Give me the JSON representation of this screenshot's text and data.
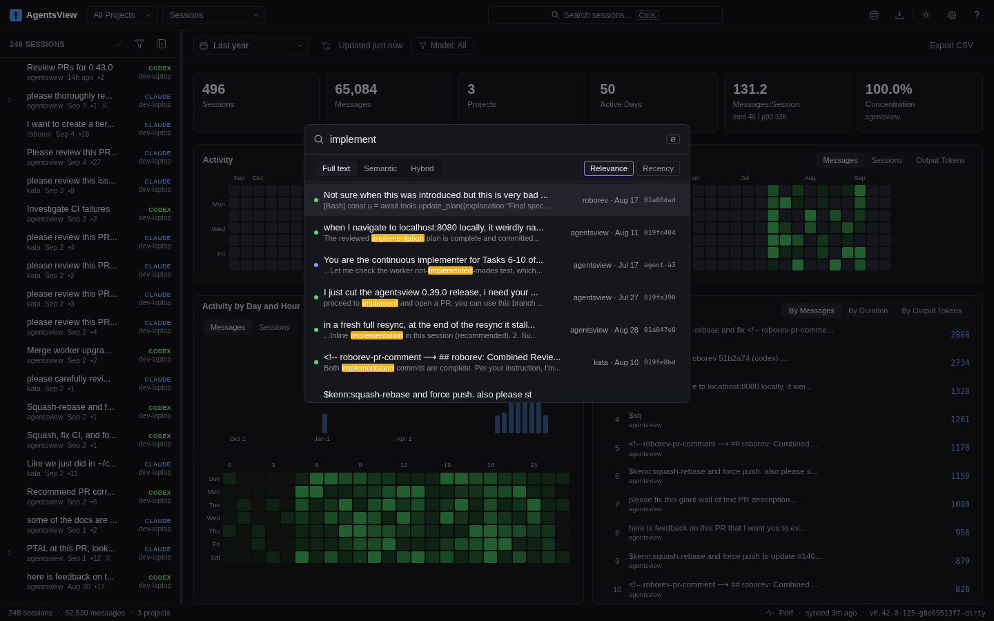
{
  "header": {
    "app_name": "AgentsView",
    "project_filter": "All Projects",
    "view_select": "Sessions",
    "search_placeholder": "Search sessions...",
    "search_shortcut": "CtrlK"
  },
  "sidebar": {
    "count_label": "248 SESSIONS",
    "items": [
      {
        "title": "Review PRs for 0.43.0",
        "project": "agentsview",
        "date": "14h ago",
        "count": "•2",
        "agent": "CODEX",
        "color": "#3f8f4f",
        "machine": "dev-laptop",
        "expandable": false,
        "person_icon": false
      },
      {
        "title": "please thoroughly re...",
        "project": "agentsview",
        "date": "Sep 7",
        "count": "•1",
        "agent": "CLAUDE",
        "color": "#3b5f94",
        "machine": "dev-laptop",
        "expandable": true,
        "person_icon": true
      },
      {
        "title": "I want to create a tier...",
        "project": "roborev",
        "date": "Sep 4",
        "count": "•18",
        "agent": "CLAUDE",
        "color": "#3b5f94",
        "machine": "dev-laptop",
        "expandable": false,
        "person_icon": false
      },
      {
        "title": "Please review this PR...",
        "project": "agentsview",
        "date": "Sep 4",
        "count": "•27",
        "agent": "CLAUDE",
        "color": "#3b5f94",
        "machine": "dev-laptop",
        "expandable": false,
        "person_icon": false
      },
      {
        "title": "please review this iss...",
        "project": "kata",
        "date": "Sep 3",
        "count": "•8",
        "agent": "CLAUDE",
        "color": "#3b5f94",
        "machine": "dev-laptop",
        "expandable": false,
        "person_icon": false
      },
      {
        "title": "Investigate CI failures",
        "project": "agentsview",
        "date": "Sep 3",
        "count": "•2",
        "agent": "CODEX",
        "color": "#3f8f4f",
        "machine": "dev-laptop",
        "expandable": false,
        "person_icon": false
      },
      {
        "title": "please review this PR...",
        "project": "kata",
        "date": "Sep 2",
        "count": "•4",
        "agent": "CLAUDE",
        "color": "#3b5f94",
        "machine": "dev-laptop",
        "expandable": false,
        "person_icon": false
      },
      {
        "title": "please review this PR...",
        "project": "kata",
        "date": "Sep 2",
        "count": "•2",
        "agent": "CLAUDE",
        "color": "#3b5f94",
        "machine": "dev-laptop",
        "expandable": false,
        "person_icon": false
      },
      {
        "title": "please review this PR...",
        "project": "kata",
        "date": "Sep 2",
        "count": "•3",
        "agent": "CLAUDE",
        "color": "#3b5f94",
        "machine": "dev-laptop",
        "expandable": false,
        "person_icon": false
      },
      {
        "title": "please review this PR...",
        "project": "agentsview",
        "date": "Sep 2",
        "count": "•4",
        "agent": "CLAUDE",
        "color": "#3b5f94",
        "machine": "dev-laptop",
        "expandable": false,
        "person_icon": false
      },
      {
        "title": "Merge worker upgra...",
        "project": "agentsview",
        "date": "Sep 2",
        "count": "•2",
        "agent": "CODEX",
        "color": "#3f8f4f",
        "machine": "dev-laptop",
        "expandable": false,
        "person_icon": false
      },
      {
        "title": "please carefully revi...",
        "project": "kata",
        "date": "Sep 2",
        "count": "•1",
        "agent": "CLAUDE",
        "color": "#3b5f94",
        "machine": "dev-laptop",
        "expandable": false,
        "person_icon": false
      },
      {
        "title": "Squash-rebase and f...",
        "project": "agentsview",
        "date": "Sep 2",
        "count": "•1",
        "agent": "CODEX",
        "color": "#3f8f4f",
        "machine": "dev-laptop",
        "expandable": false,
        "person_icon": false
      },
      {
        "title": "Squash, fix CI, and fo...",
        "project": "agentsview",
        "date": "Sep 2",
        "count": "•1",
        "agent": "CODEX",
        "color": "#3f8f4f",
        "machine": "dev-laptop",
        "expandable": false,
        "person_icon": false
      },
      {
        "title": "Like we just did in ~/c...",
        "project": "kata",
        "date": "Sep 2",
        "count": "•11",
        "agent": "CLAUDE",
        "color": "#3b5f94",
        "machine": "dev-laptop",
        "expandable": false,
        "person_icon": false
      },
      {
        "title": "Recommend PR corr...",
        "project": "agentsview",
        "date": "Sep 2",
        "count": "•5",
        "agent": "CODEX",
        "color": "#3f8f4f",
        "machine": "dev-laptop",
        "expandable": false,
        "person_icon": false
      },
      {
        "title": "some of the docs are ...",
        "project": "agentsview",
        "date": "Sep 1",
        "count": "•2",
        "agent": "CLAUDE",
        "color": "#3b5f94",
        "machine": "dev-laptop",
        "expandable": false,
        "person_icon": false
      },
      {
        "title": "PTAL at this PR, look...",
        "project": "agentsview",
        "date": "Sep 1",
        "count": "•12",
        "agent": "CLAUDE",
        "color": "#3b5f94",
        "machine": "dev-laptop",
        "expandable": true,
        "person_icon": true
      },
      {
        "title": "here is feedback on t...",
        "project": "agentsview",
        "date": "Aug 30",
        "count": "•17",
        "agent": "CODEX",
        "color": "#3f8f4f",
        "machine": "dev-laptop",
        "expandable": false,
        "person_icon": false
      }
    ]
  },
  "toolbar": {
    "date_range": "Last year",
    "updated": "Updated just now",
    "model_filter": "Model: All",
    "export": "Export CSV"
  },
  "stats": [
    {
      "value": "496",
      "label": "Sessions"
    },
    {
      "value": "65,084",
      "label": "Messages"
    },
    {
      "value": "3",
      "label": "Projects"
    },
    {
      "value": "50",
      "label": "Active Days"
    },
    {
      "value": "131.2",
      "label": "Messages/Session",
      "sub": "med 46 / p90 336"
    },
    {
      "value": "100.0%",
      "label": "Concentration",
      "sub": "agentsview"
    }
  ],
  "activity": {
    "title": "Activity",
    "left_months": [
      "Sep",
      "Oct"
    ],
    "right_months": [
      "un",
      "Jul",
      "Aug",
      "Sep"
    ],
    "days": [
      "Mon",
      "Wed",
      "Fri"
    ],
    "tabs": [
      {
        "label": "Messages",
        "selected": true
      },
      {
        "label": "Sessions",
        "selected": false
      },
      {
        "label": "Output Tokens",
        "selected": false
      }
    ]
  },
  "day_hour": {
    "title": "Activity by Day and Hour",
    "tabs": [
      {
        "label": "Messages",
        "selected": true
      },
      {
        "label": "Sessions",
        "selected": false
      }
    ],
    "axis_labels": [
      "Oct 1",
      "Jan 1",
      "Apr 1"
    ],
    "hours": [
      "0",
      "3",
      "6",
      "9",
      "12",
      "15",
      "18",
      "21"
    ],
    "days": [
      "Sun",
      "Mon",
      "Tue",
      "Wed",
      "Thu",
      "Fri",
      "Sat"
    ]
  },
  "top_sessions": {
    "tabs": [
      {
        "label": "By Messages",
        "selected": true
      },
      {
        "label": "By Duration",
        "selected": false
      },
      {
        "label": "By Output Tokens",
        "selected": false
      }
    ],
    "rows": [
      {
        "title": "-rebase and fix <!-- roborev-pr-comme...",
        "value": "2888"
      },
      {
        "title": "oborev 51b2a74 (codex) ...",
        "value": "2734"
      },
      {
        "title": "e to localhost:8080 locally, it wei...",
        "value": "1328"
      },
      {
        "rank": "4",
        "title": "$sq",
        "project": "agentsview",
        "value": "1261"
      },
      {
        "rank": "5",
        "title": "<!-- roborev-pr-comment ⟶ ## roborev: Combined ...",
        "project": "agentsview",
        "value": "1170"
      },
      {
        "rank": "6",
        "title": "$kenn:squash-rebase and force push. also please s...",
        "project": "agentsview",
        "value": "1159"
      },
      {
        "rank": "7",
        "title": "please fix this giant wall of text PR description...",
        "project": "agentsview",
        "value": "1080"
      },
      {
        "rank": "8",
        "title": "here is feedback on this PR that I want you to ev...",
        "project": "agentsview",
        "value": "956"
      },
      {
        "rank": "9",
        "title": "$kenn:squash-rebase and force push to update #146...",
        "project": "agentsview",
        "value": "879"
      },
      {
        "rank": "10",
        "title": "<!-- roborev-pr-comment ⟶ ## roborev: Combined ...",
        "project": "agentsview",
        "value": "828"
      }
    ]
  },
  "search_modal": {
    "query": "implement",
    "modes": [
      {
        "label": "Full text",
        "selected": true
      },
      {
        "label": "Semantic",
        "selected": false
      },
      {
        "label": "Hybrid",
        "selected": false
      }
    ],
    "sorts": [
      {
        "label": "Relevance",
        "selected": true
      },
      {
        "label": "Recency",
        "selected": false
      }
    ],
    "results": [
      {
        "title": "Not sure when this was introduced but this is very bad ...",
        "before": "[Bash] const u = await tools.update_plan({explanation:\"Final spec...",
        "meta": "roborev · Aug 17",
        "id": "01a00dad",
        "color": "#4ade80",
        "selected": true
      },
      {
        "title": "when I navigate to localhost:8080 locally, it weirdly na...",
        "before": "The reviewed ",
        "match": "implementation",
        "after": " plan is complete and committed...",
        "meta": "agentsview · Aug 11",
        "id": "019fe404",
        "color": "#4ade80",
        "selected": false
      },
      {
        "title": "You are the continuous implementer for Tasks 6-10 of...",
        "before": "...Let me check the worker not-",
        "match": "implemented",
        "after": "-modes test, which...",
        "meta": "agentsview · Jul 17",
        "id": "agent-a3",
        "color": "#60a5fa",
        "selected": false
      },
      {
        "title": "I just cut the agentsview 0.39.0 release, i need your ...",
        "before": "proceed to ",
        "match": "implement",
        "after": " and open a PR, you can use this branch ...",
        "meta": "agentsview · Jul 27",
        "id": "019fa390",
        "color": "#4ade80",
        "selected": false
      },
      {
        "title": "in a fresh full resync, at the end of the resync it stall...",
        "before": "...Inline ",
        "match": "implementation",
        "after": " in this session (recommended). 2. Su...",
        "meta": "agentsview · Aug 28",
        "id": "01a047e6",
        "color": "#4ade80",
        "selected": false
      },
      {
        "title": "<!-- roborev-pr-comment ⟶ ## roborev: Combined Revie...",
        "before": "Both ",
        "match": "implementation",
        "after": " commits are complete. Per your instruction, I'm...",
        "meta": "kata · Aug 10",
        "id": "019fe8bd",
        "color": "#4ade80",
        "selected": false
      },
      {
        "title": "$kenn:squash-rebase and force push. also please st"
      }
    ]
  },
  "status_bar": {
    "items": [
      "248 sessions",
      "52,530 messages",
      "3 projects"
    ],
    "perf": "Perf",
    "synced": "synced 3m ago",
    "version": "v0.42.0-125-g8e69513f7-dirty"
  }
}
